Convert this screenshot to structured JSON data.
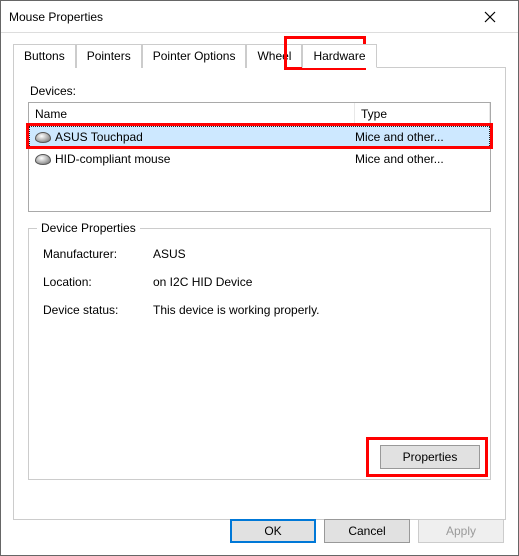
{
  "window": {
    "title": "Mouse Properties"
  },
  "tabs": {
    "items": [
      {
        "label": "Buttons"
      },
      {
        "label": "Pointers"
      },
      {
        "label": "Pointer Options"
      },
      {
        "label": "Wheel"
      },
      {
        "label": "Hardware"
      }
    ],
    "activeIndex": 4
  },
  "devices": {
    "label": "Devices:",
    "columns": {
      "name": "Name",
      "type": "Type"
    },
    "rows": [
      {
        "name": "ASUS Touchpad",
        "type": "Mice and other...",
        "selected": true
      },
      {
        "name": "HID-compliant mouse",
        "type": "Mice and other...",
        "selected": false
      }
    ]
  },
  "deviceProperties": {
    "title": "Device Properties",
    "manufacturerLabel": "Manufacturer:",
    "manufacturerValue": "ASUS",
    "locationLabel": "Location:",
    "locationValue": "on I2C HID Device",
    "statusLabel": "Device status:",
    "statusValue": "This device is working properly.",
    "propertiesButton": "Properties"
  },
  "dialogButtons": {
    "ok": "OK",
    "cancel": "Cancel",
    "apply": "Apply"
  }
}
